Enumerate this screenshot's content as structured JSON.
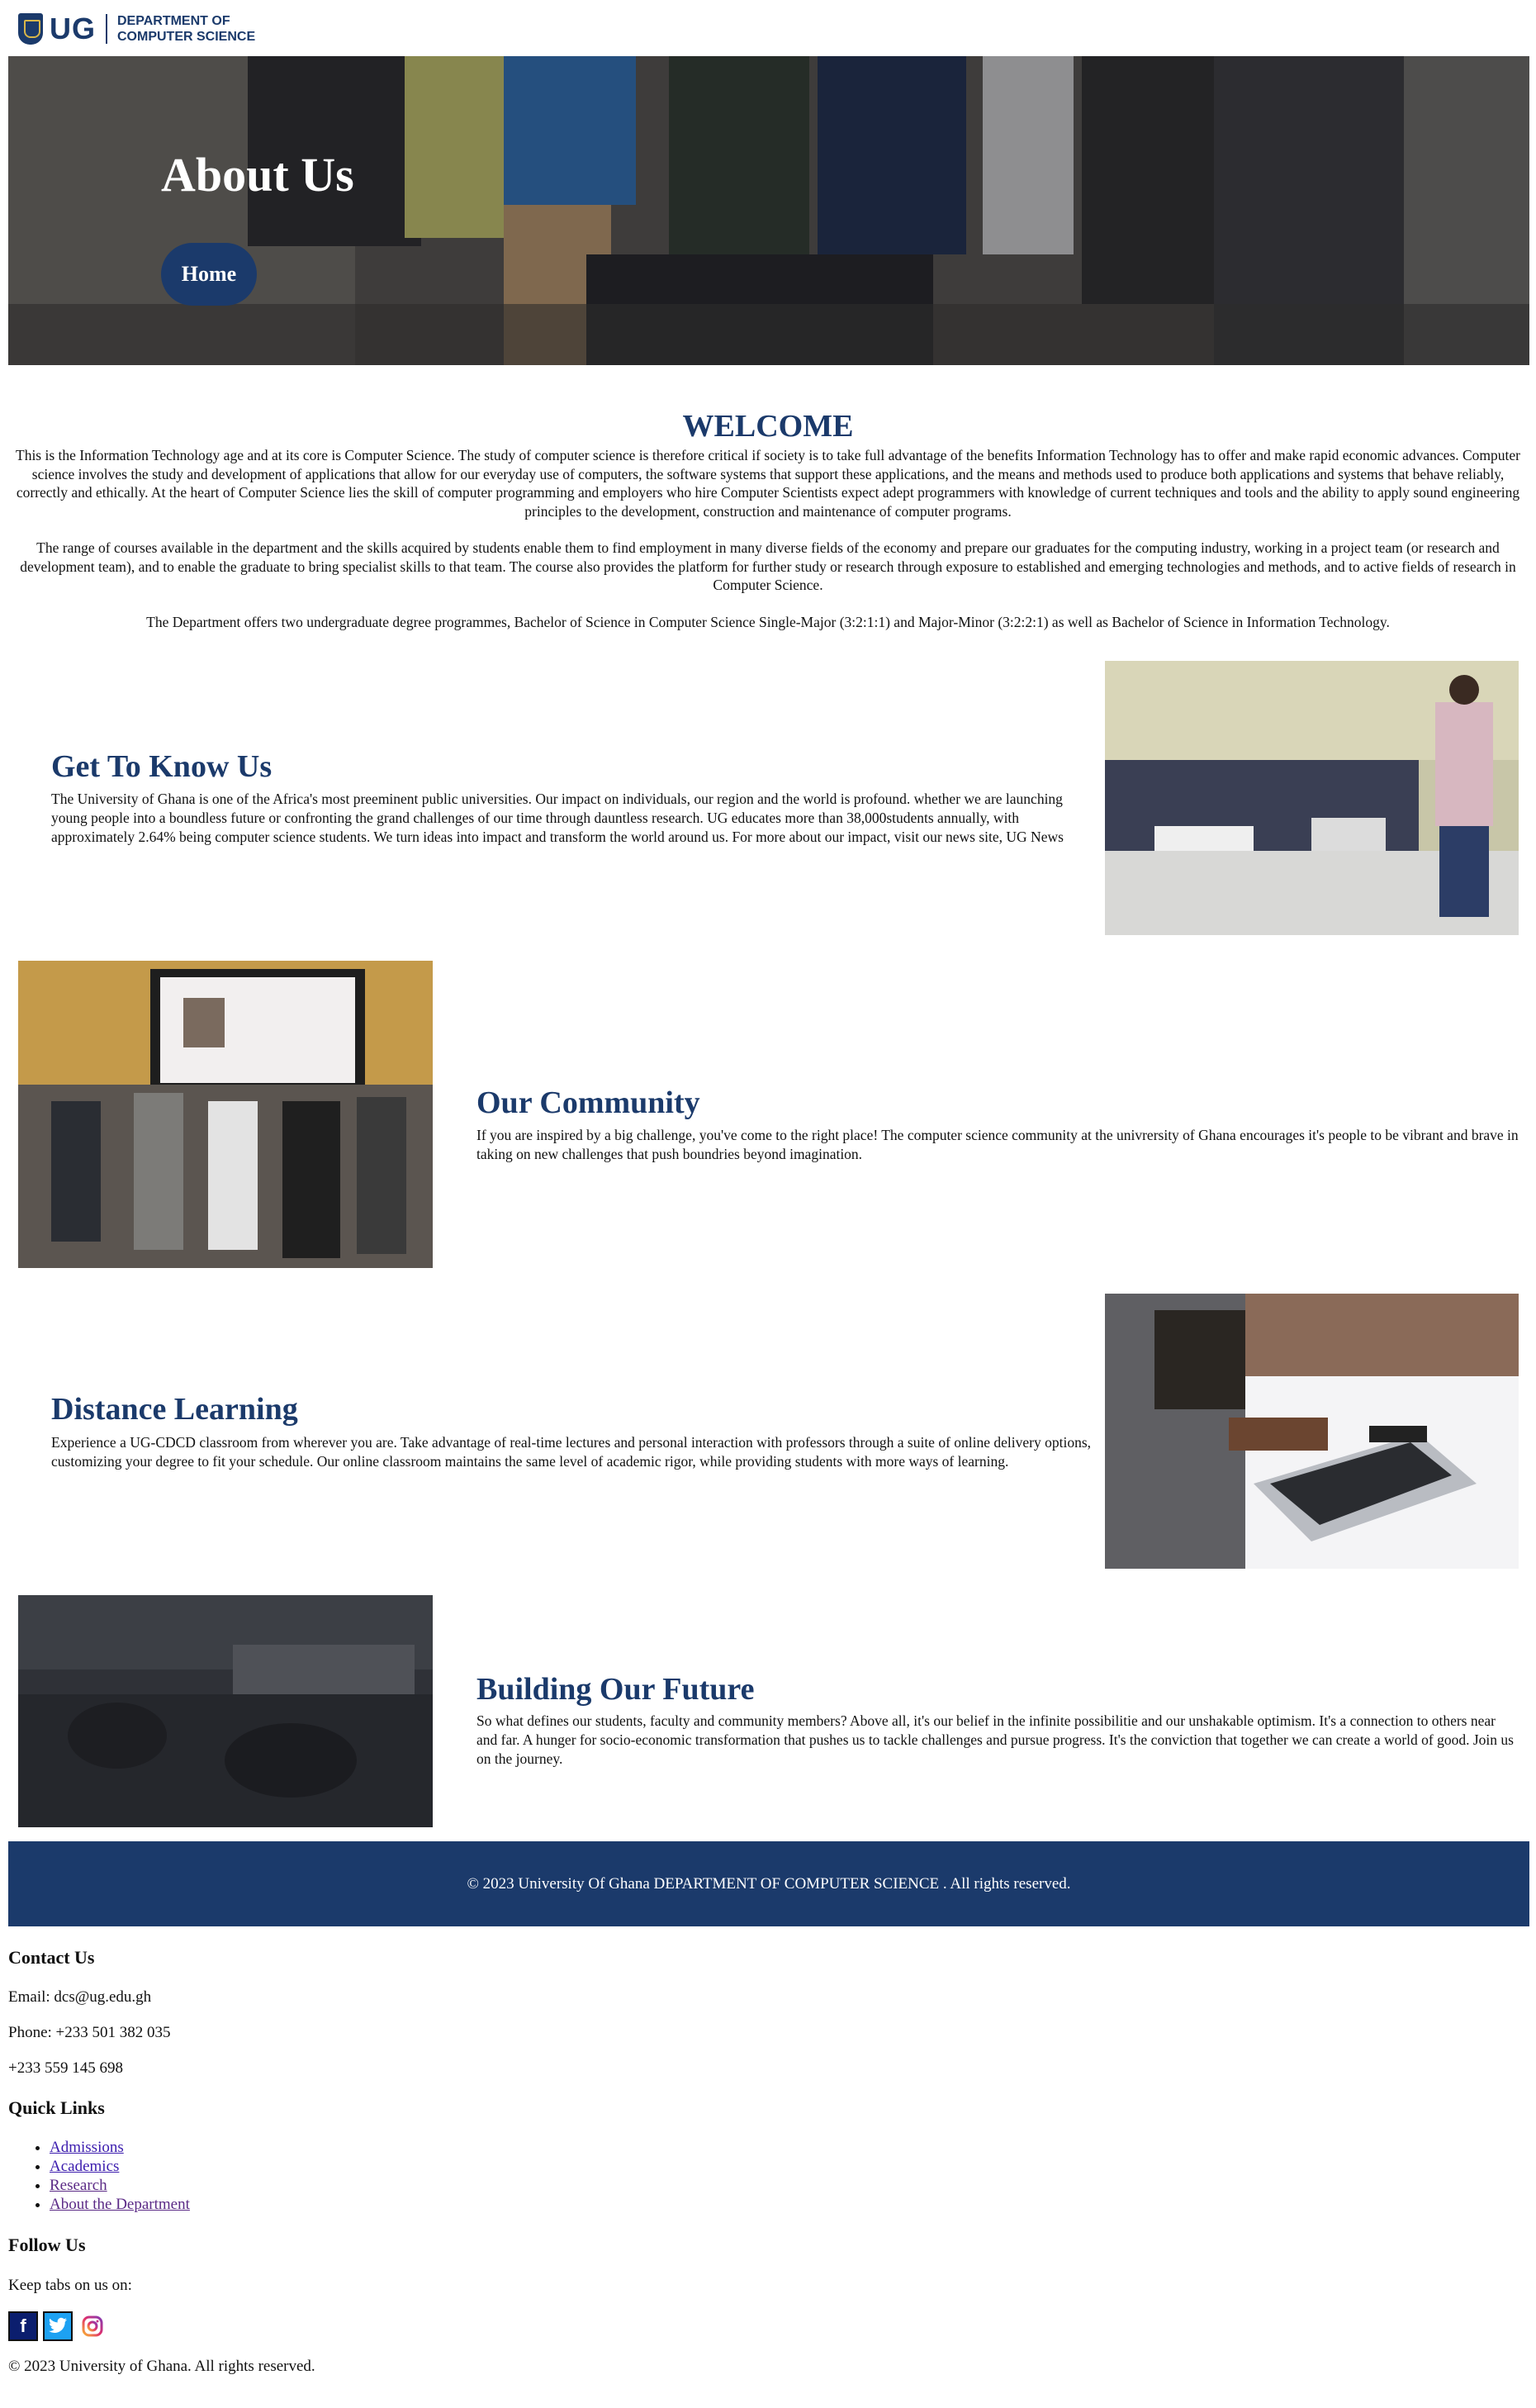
{
  "header": {
    "logo_mark": "UG",
    "dept_line1": "DEPARTMENT OF",
    "dept_line2": "COMPUTER SCIENCE"
  },
  "hero": {
    "title": "About Us",
    "home_button": "Home"
  },
  "welcome": {
    "title": "WELCOME",
    "paragraphs": [
      "This is the Information Technology age and at its core is Computer Science. The study of computer science is therefore critical if society is to take full advantage of the benefits Information Technology has to offer and make rapid economic advances. Computer science involves the study and development of applications that allow for our everyday use of computers, the software systems that support these applications, and the means and methods used to produce both applications and systems that behave reliably, correctly and ethically. At the heart of Computer Science lies the skill of computer programming and employers who hire Computer Scientists expect adept programmers with knowledge of current techniques and tools and the ability to apply sound engineering principles to the development, construction and maintenance of computer programs.",
      "The range of courses available in the department and the skills acquired by students enable them to find employment in many diverse fields of the economy and prepare our graduates for the computing industry, working in a project team (or research and development team), and to enable the graduate to bring specialist skills to that team. The course also provides the platform for further study or research through exposure to established and emerging technologies and methods, and to active fields of research in Computer Science.",
      "The Department offers two undergraduate degree programmes, Bachelor of Science in Computer Science Single-Major (3:2:1:1) and Major-Minor (3:2:2:1) as well as Bachelor of Science in Information Technology."
    ]
  },
  "sections": [
    {
      "title": "Get To Know Us",
      "text": "The University of Ghana is one of the Africa's most preeminent public universities. Our impact on individuals, our region and the world is profound. whether we are launching young people into a boundless future or confronting the grand challenges of our time through dauntless research. UG educates more than 38,000students annually, with approximately 2.64% being computer science students. We turn ideas into impact and transform the world around us. For more about our impact, visit our news site, UG News"
    },
    {
      "title": "Our Community",
      "text": "If you are inspired by a big challenge, you've come to the right place! The computer science community at the univrersity of Ghana encourages it's people to be vibrant and brave in taking on new challenges that push boundries beyond imagination."
    },
    {
      "title": "Distance Learning",
      "text": "Experience a UG-CDCD classroom from wherever you are. Take advantage of real-time lectures and personal interaction with professors through a suite of online delivery options, customizing your degree to fit your schedule. Our online classroom maintains the same level of academic rigor, while providing students with more ways of learning."
    },
    {
      "title": "Building Our Future",
      "text": "So what defines our students, faculty and community members? Above all, it's our belief in the infinite possibilitie and our unshakable optimism. It's a connection to others near and far. A hunger for socio-economic transformation that pushes us to tackle challenges and pursue progress. It's the conviction that together we can create a world of good. Join us on the journey."
    }
  ],
  "footer": {
    "copyright_band": "© 2023 University Of Ghana DEPARTMENT OF COMPUTER SCIENCE . All rights reserved.",
    "contact_title": "Contact Us",
    "email": "Email: dcs@ug.edu.gh",
    "phone1": "Phone: +233 501 382 035",
    "phone2": "+233 559 145 698",
    "quick_links_title": "Quick Links",
    "links": [
      "Admissions",
      "Academics",
      "Research",
      "About the Department"
    ],
    "follow_title": "Follow Us",
    "follow_text": "Keep tabs on us on:",
    "socials": [
      "facebook-icon",
      "twitter-icon",
      "instagram-icon"
    ],
    "bottom_copyright": "© 2023 University of Ghana. All rights reserved."
  },
  "colors": {
    "brand_navy": "#1b3a6b",
    "link_blue": "#3b1cae",
    "link_visited": "#5b2a86"
  }
}
